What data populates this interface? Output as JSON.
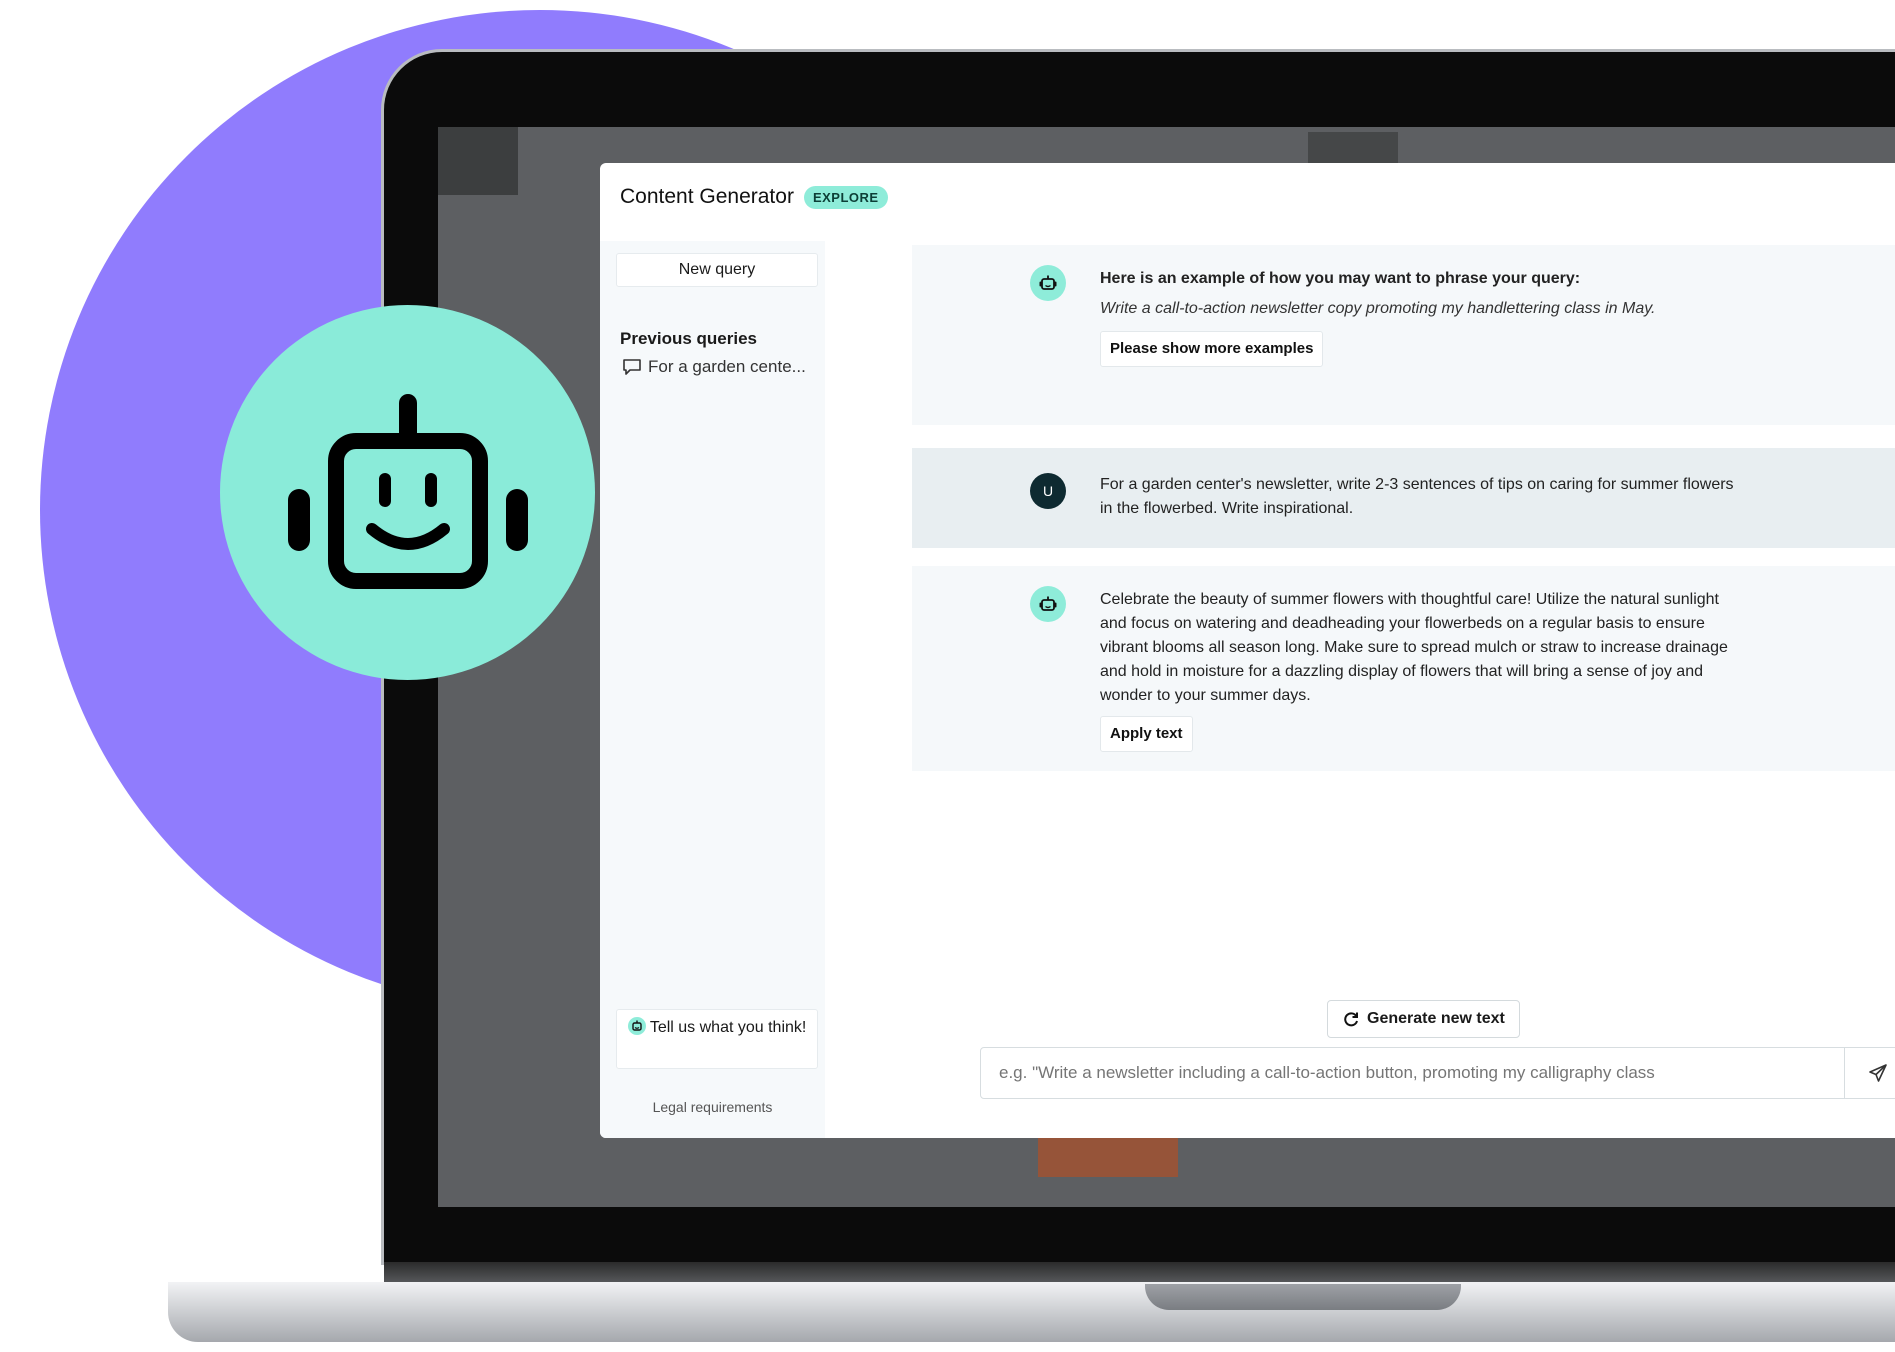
{
  "modal": {
    "title": "Content Generator",
    "badge": "EXPLORE"
  },
  "sidebar": {
    "new_query_label": "New query",
    "previous_label": "Previous queries",
    "previous_items": [
      "For a garden cente..."
    ],
    "feedback_label": "Tell us what you think!",
    "legal_label": "Legal requirements"
  },
  "messages": [
    {
      "role": "bot",
      "heading": "Here is an example of how you may want to phrase your query:",
      "example": "Write a call-to-action newsletter copy promoting my handlettering class in May.",
      "action_label": "Please show more examples"
    },
    {
      "role": "user",
      "avatar_letter": "U",
      "text": "For a garden center's newsletter, write 2-3 sentences of tips on caring for summer flowers in the flowerbed. Write inspirational."
    },
    {
      "role": "bot",
      "text": "Celebrate the beauty of summer flowers with thoughtful care! Utilize the natural sunlight and focus on watering and deadheading your flowerbeds on a regular basis to ensure vibrant blooms all season long. Make sure to spread mulch or straw to increase drainage and hold in moisture for a dazzling display of flowers that will bring a sense of joy and wonder to your summer days.",
      "action_label": "Apply text"
    }
  ],
  "composer": {
    "generate_label": "Generate new text",
    "placeholder": "e.g. \"Write a newsletter including a call-to-action button, promoting my calligraphy class"
  },
  "colors": {
    "brand_mint": "#8eecd9",
    "blob_purple": "#907cfd"
  }
}
